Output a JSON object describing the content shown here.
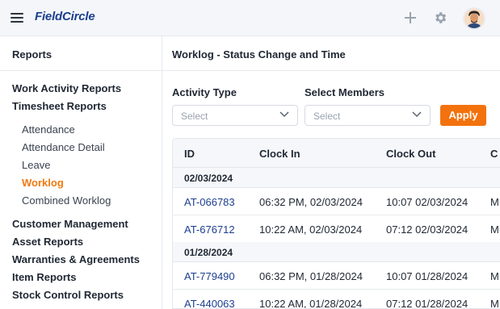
{
  "app": {
    "logo": "FieldCircle"
  },
  "header": {
    "icons": [
      "menu-icon",
      "plus-icon",
      "gear-icon",
      "avatar"
    ]
  },
  "sidebar": {
    "title": "Reports",
    "groups": [
      "Work Activity Reports",
      "Timesheet Reports",
      "Customer Management",
      "Asset Reports",
      "Warranties & Agreements",
      "Item Reports",
      "Stock Control Reports"
    ],
    "timesheet_items": [
      "Attendance",
      "Attendance Detail",
      "Leave",
      "Worklog",
      "Combined Worklog"
    ],
    "active_item": "Worklog"
  },
  "main": {
    "title": "Worklog - Status Change and Time",
    "filters": {
      "activity_type_label": "Activity Type",
      "activity_type_placeholder": "Select",
      "members_label": "Select Members",
      "members_placeholder": "Select",
      "apply_label": "Apply"
    },
    "table": {
      "columns": [
        "ID",
        "Clock In",
        "Clock Out",
        "C"
      ],
      "groups": [
        {
          "date": "02/03/2024",
          "rows": [
            {
              "id": "AT-066783",
              "clock_in": "06:32 PM, 02/03/2024",
              "clock_out": "10:07 02/03/2024",
              "extra": "M"
            },
            {
              "id": "AT-676712",
              "clock_in": "10:22 AM, 02/03/2024",
              "clock_out": "07:12 02/03/2024",
              "extra": "M"
            }
          ]
        },
        {
          "date": "01/28/2024",
          "rows": [
            {
              "id": "AT-779490",
              "clock_in": "06:32 PM, 01/28/2024",
              "clock_out": "10:07 01/28/2024",
              "extra": "M"
            },
            {
              "id": "AT-440063",
              "clock_in": "10:22 AM, 01/28/2024",
              "clock_out": "07:12 01/28/2024",
              "extra": "M"
            }
          ]
        }
      ]
    }
  },
  "colors": {
    "accent": "#f3720d",
    "brand": "#1d3f8f",
    "active_nav": "#f17a10"
  }
}
